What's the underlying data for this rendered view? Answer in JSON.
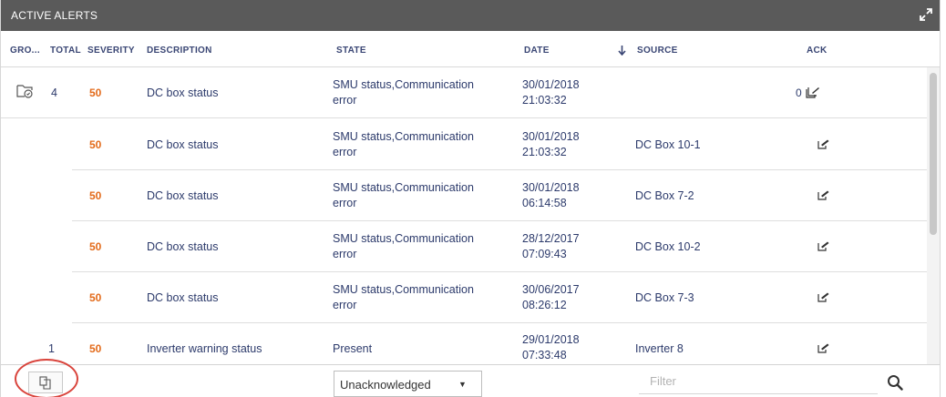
{
  "panel": {
    "title": "ACTIVE ALERTS",
    "expand_icon": "expand-arrows-icon"
  },
  "columns": {
    "group": "GRO...",
    "total": "TOTAL",
    "severity": "SEVERITY",
    "description": "DESCRIPTION",
    "state": "STATE",
    "date": "DATE",
    "sort_icon": "sort-down-arrow-icon",
    "source": "SOURCE",
    "ack": "ACK"
  },
  "groups": [
    {
      "total": "4",
      "severity": "50",
      "description": "DC box status",
      "state_line1": "SMU status,Communication",
      "state_line2": "error",
      "date_line1": "30/01/2018",
      "date_line2": "21:03:32",
      "source": "",
      "ack_count": "0",
      "group_icon": "folder-alerts-icon",
      "ack_icon": "ack-all-edit-icon"
    }
  ],
  "rows": [
    {
      "severity": "50",
      "description": "DC box status",
      "state_line1": "SMU status,Communication",
      "state_line2": "error",
      "date_line1": "30/01/2018",
      "date_line2": "21:03:32",
      "source": "DC Box 10-1"
    },
    {
      "severity": "50",
      "description": "DC box status",
      "state_line1": "SMU status,Communication",
      "state_line2": "error",
      "date_line1": "30/01/2018",
      "date_line2": "06:14:58",
      "source": "DC Box 7-2"
    },
    {
      "severity": "50",
      "description": "DC box status",
      "state_line1": "SMU status,Communication",
      "state_line2": "error",
      "date_line1": "28/12/2017",
      "date_line2": "07:09:43",
      "source": "DC Box 10-2"
    },
    {
      "severity": "50",
      "description": "DC box status",
      "state_line1": "SMU status,Communication",
      "state_line2": "error",
      "date_line1": "30/06/2017",
      "date_line2": "08:26:12",
      "source": "DC Box 7-3"
    }
  ],
  "single": {
    "total": "1",
    "severity": "50",
    "description": "Inverter warning status",
    "state": "Present",
    "date_line1": "29/01/2018",
    "date_line2": "07:33:48",
    "source": "Inverter 8"
  },
  "footer": {
    "copy_icon": "copy-icon",
    "select_value": "Unacknowledged",
    "filter_placeholder": "Filter",
    "search_icon": "search-icon"
  },
  "colors": {
    "titlebar": "#5a5a5a",
    "severity": "#e36b1b",
    "text": "#2c3a6b",
    "highlight_circle": "#d9443c"
  }
}
